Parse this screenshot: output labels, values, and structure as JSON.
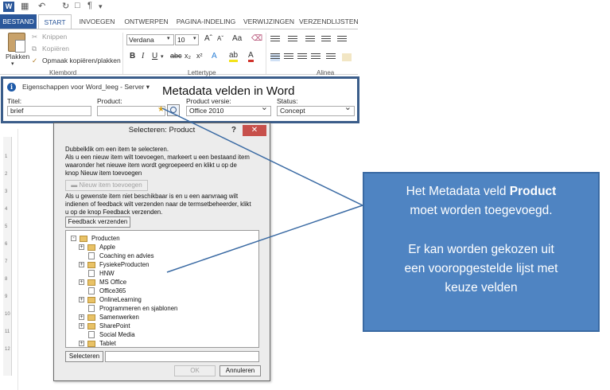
{
  "app": {
    "tabs": [
      "BESTAND",
      "START",
      "INVOEGEN",
      "ONTWERPEN",
      "PAGINA-INDELING",
      "VERWIJZINGEN",
      "VERZENDLIJSTEN"
    ],
    "active_tab": "START"
  },
  "ribbon": {
    "paste_label": "Plakken",
    "cut_label": "Knippen",
    "copy_label": "Kopiëren",
    "format_painter_label": "Opmaak kopiëren/plakken",
    "clipboard_group": "Klembord",
    "font_name": "Verdana",
    "font_size": "10",
    "font_group": "Lettertype",
    "paragraph_group": "Alinea"
  },
  "metadata_panel": {
    "server_label": "Eigenschappen voor Word_leeg - Server",
    "heading": "Metadata velden in Word",
    "titel_label": "Titel:",
    "titel_value": "brief",
    "product_label": "Product:",
    "product_value": "",
    "product_versie_label": "Product versie:",
    "product_versie_value": "Office 2010",
    "status_label": "Status:",
    "status_value": "Concept"
  },
  "ruler": {
    "marks": [
      "1",
      "2",
      "3",
      "4",
      "5",
      "6",
      "7",
      "8",
      "9",
      "10",
      "11",
      "12"
    ]
  },
  "dialog": {
    "title": "Selecteren: Product",
    "help": "?",
    "close": "✕",
    "instructions": [
      "Dubbelklik om een item te selecteren.",
      "Als u een nieuw item wilt toevoegen, markeert u een bestaand item",
      "waaronder het nieuwe item wordt gegroepeerd en klikt u op de",
      "knop Nieuw item toevoegen"
    ],
    "new_item_button": "Nieuw item toevoegen",
    "feedback_text": [
      "Als u gewenste item niet beschikbaar is en u een aanvraag wilt",
      "indienen of feedback wilt verzenden naar de termsetbeheerder, klikt",
      "u op de knop Feedback verzenden."
    ],
    "feedback_button": "Feedback verzenden",
    "tree": {
      "root": "Producten",
      "items": [
        {
          "label": "Apple",
          "expandable": true
        },
        {
          "label": "Coaching en advies",
          "expandable": false
        },
        {
          "label": "FysiekeProducten",
          "expandable": true
        },
        {
          "label": "HNW",
          "expandable": false
        },
        {
          "label": "MS Office",
          "expandable": true
        },
        {
          "label": "Office365",
          "expandable": false
        },
        {
          "label": "OnlineLearning",
          "expandable": true
        },
        {
          "label": "Programmeren en sjablonen",
          "expandable": false
        },
        {
          "label": "Samenwerken",
          "expandable": true
        },
        {
          "label": "SharePoint",
          "expandable": true
        },
        {
          "label": "Social Media",
          "expandable": false
        },
        {
          "label": "Tablet",
          "expandable": true
        }
      ]
    },
    "select_button": "Selecteren",
    "ok_button": "OK",
    "cancel_button": "Annuleren"
  },
  "callout": {
    "line1_prefix": "Het Metadata veld ",
    "line1_bold": "Product",
    "line2": "moet worden toegevoegd.",
    "para2": [
      "Er kan worden gekozen uit",
      "een vooropgestelde lijst met",
      "keuze velden"
    ]
  },
  "colors": {
    "word_blue": "#2b579a",
    "callout_fill": "#4f84c2",
    "panel_border": "#3b5d8a",
    "close_red": "#c7504b"
  }
}
